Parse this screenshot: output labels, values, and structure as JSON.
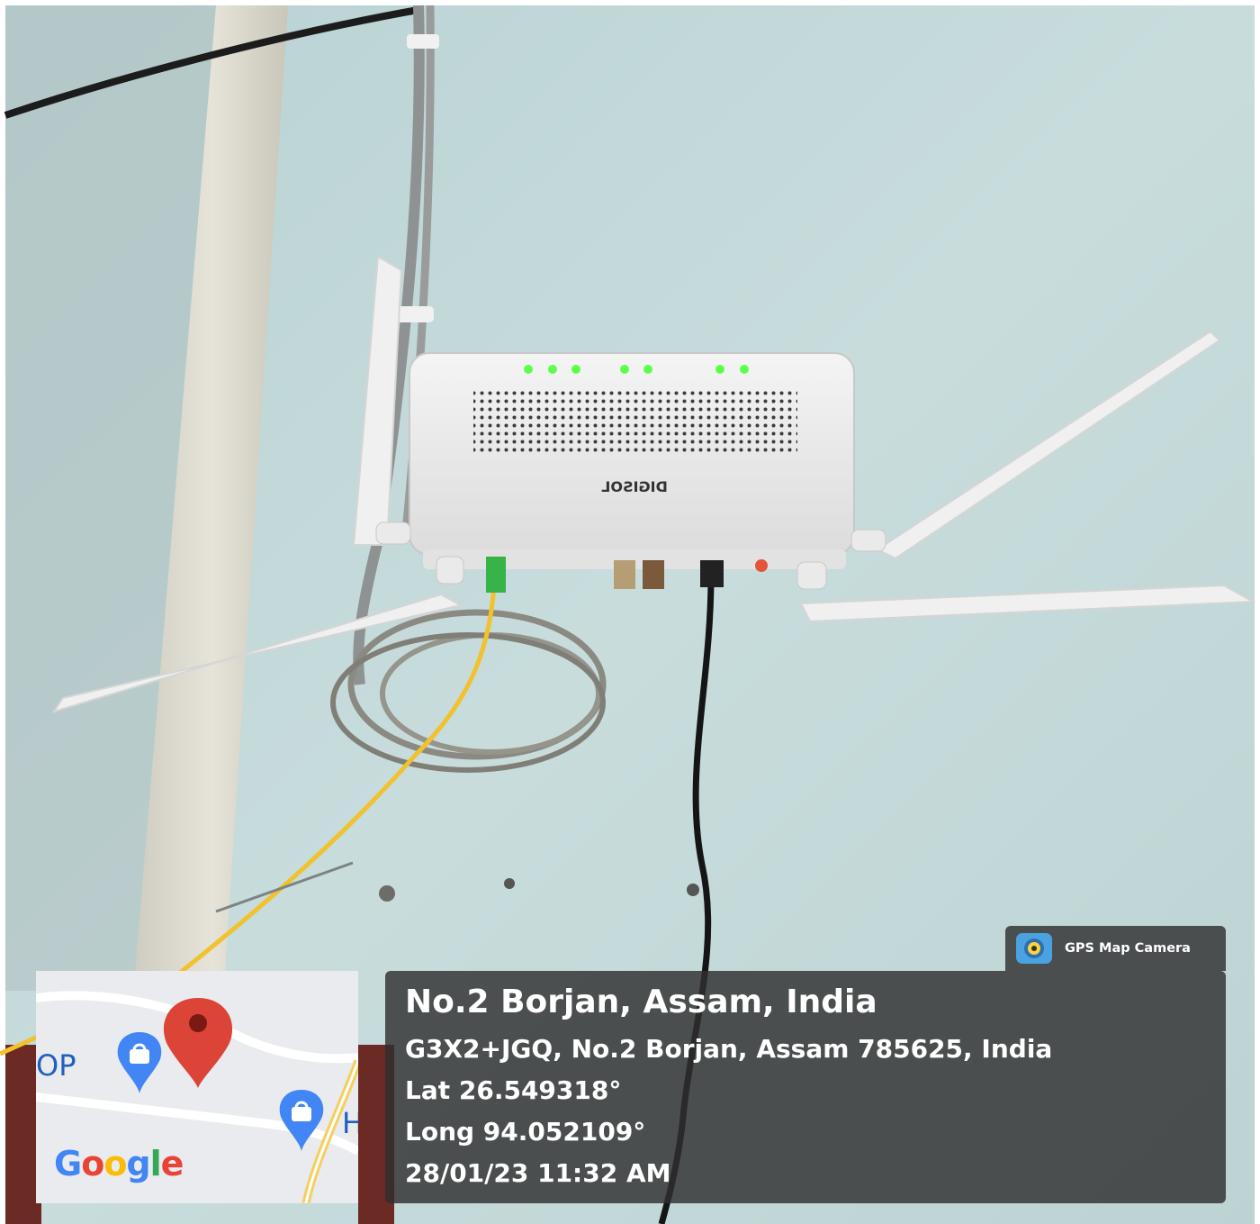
{
  "overlay": {
    "app_name": "GPS Map Camera",
    "place_title": "No.2 Borjan, Assam, India",
    "address": "G3X2+JGQ, No.2 Borjan, Assam 785625, India",
    "latitude": "Lat 26.549318°",
    "longitude": "Long 94.052109°",
    "datetime": "28/01/23 11:32 AM"
  },
  "map": {
    "partial_label_left": "OP",
    "partial_label_right": "H",
    "logo": "Google",
    "logo_colors": [
      "#4285F4",
      "#EA4335",
      "#FBBC05",
      "#4285F4",
      "#34A853",
      "#EA4335"
    ],
    "pin_color": "#DB4437",
    "poi_color": "#4285F4"
  },
  "device": {
    "brand_text_mirrored": "DIGISOL"
  },
  "colors": {
    "wall": "#c9dcdc",
    "router": "#eeeeee",
    "led": "#5dff4a",
    "fiber_cable": "#f2c12e",
    "overlay_bg": "#303030"
  }
}
